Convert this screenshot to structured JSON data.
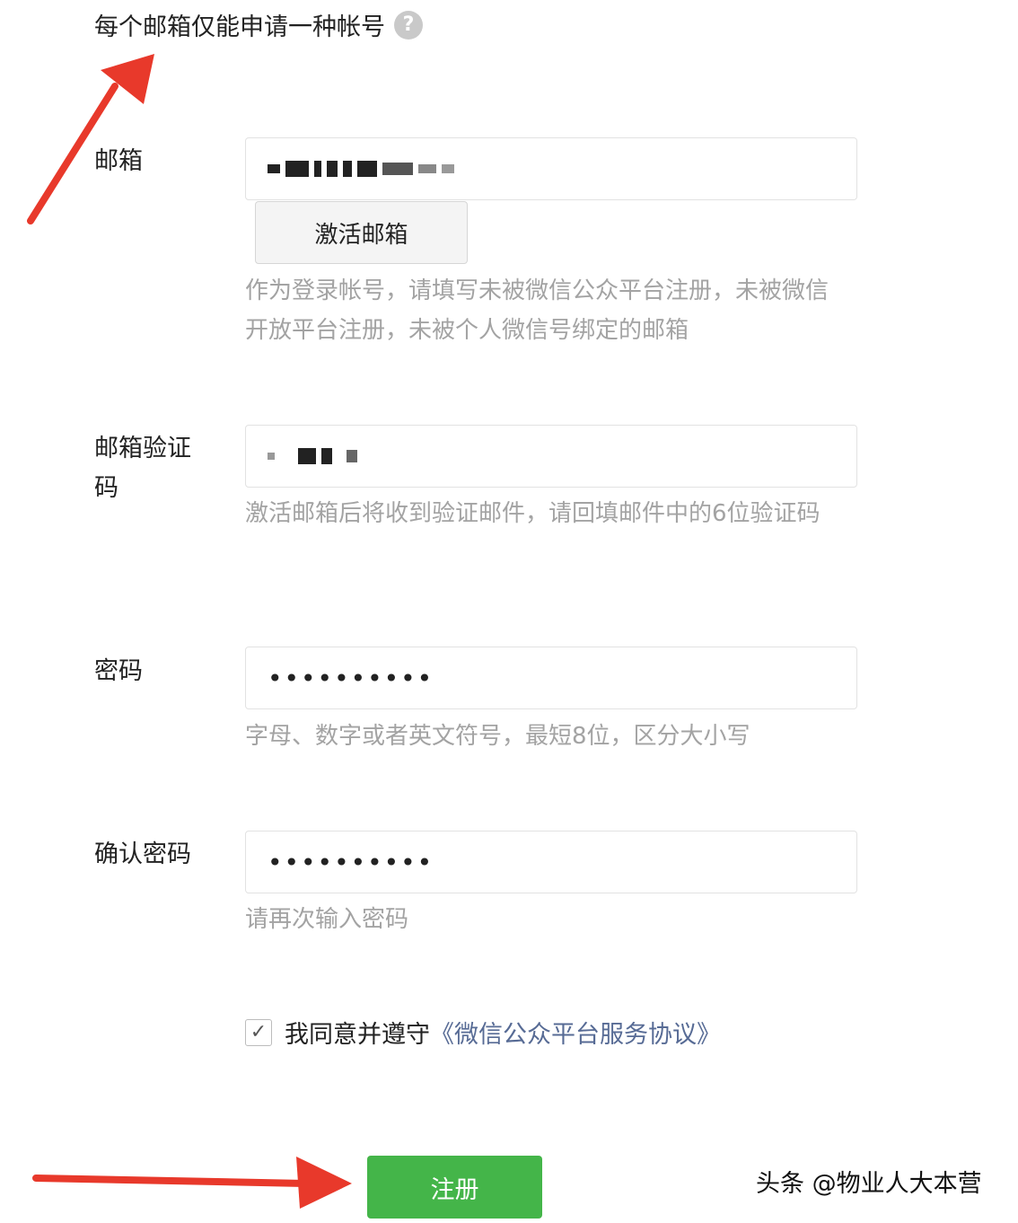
{
  "notice": {
    "text": "每个邮箱仅能申请一种帐号",
    "help_icon": "?"
  },
  "email": {
    "label": "邮箱",
    "activate_button": "激活邮箱",
    "hint": "作为登录帐号，请填写未被微信公众平台注册，未被微信开放平台注册，未被个人微信号绑定的邮箱"
  },
  "code": {
    "label": "邮箱验证码",
    "hint": "激活邮箱后将收到验证邮件，请回填邮件中的6位验证码"
  },
  "password": {
    "label": "密码",
    "value": "••••••••••",
    "hint": "字母、数字或者英文符号，最短8位，区分大小写"
  },
  "confirm_password": {
    "label": "确认密码",
    "value": "••••••••••",
    "hint": "请再次输入密码"
  },
  "agreement": {
    "checked": true,
    "text": "我同意并遵守",
    "link": "《微信公众平台服务协议》"
  },
  "register_button": "注册",
  "watermark": "头条 @物业人大本营",
  "colors": {
    "primary": "#44b549",
    "link": "#576b95",
    "hint": "#a3a3a3",
    "arrow": "#e8392b"
  }
}
